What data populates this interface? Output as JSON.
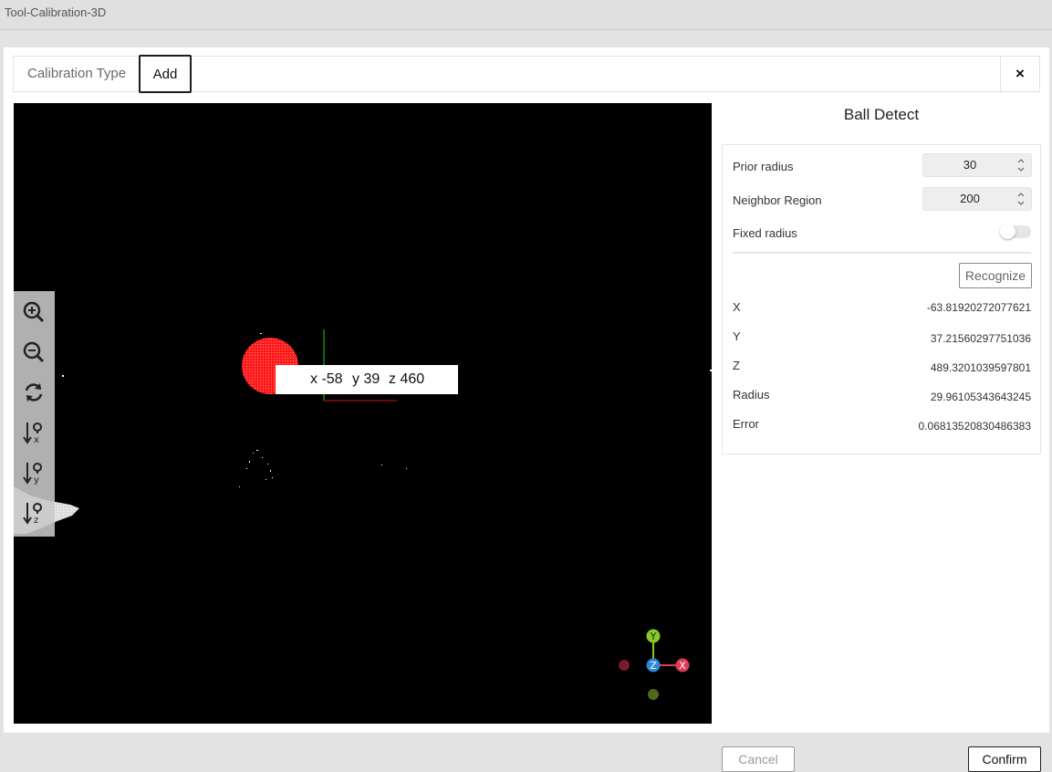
{
  "window": {
    "title": "Tool-Calibration-3D"
  },
  "tabs": [
    {
      "label": "Calibration Type"
    },
    {
      "label": "Add"
    }
  ],
  "close_icon": "×",
  "viewer": {
    "toolbar": [
      "zoom-in-icon",
      "zoom-out-icon",
      "reset-view-icon",
      "view-x-axis-icon",
      "view-y-axis-icon",
      "view-z-axis-icon"
    ],
    "popup": {
      "x": "x -58",
      "y": "y 39",
      "z": "z 460"
    },
    "axes": {
      "x": "X",
      "y": "Y",
      "z": "Z"
    },
    "colors": {
      "background": "#000000",
      "ball": "#ff1a1a"
    }
  },
  "panel": {
    "title": "Ball Detect",
    "prior_radius": {
      "label": "Prior radius",
      "value": "30"
    },
    "neighbor_region": {
      "label": "Neighbor Region",
      "value": "200"
    },
    "fixed_radius": {
      "label": "Fixed radius",
      "on": false
    },
    "recognize": "Recognize",
    "results": [
      {
        "label": "X",
        "value": "-63.81920272077621"
      },
      {
        "label": "Y",
        "value": "37.21560297751036"
      },
      {
        "label": "Z",
        "value": "489.3201039597801"
      },
      {
        "label": "Radius",
        "value": "29.96105343643245"
      },
      {
        "label": "Error",
        "value": "0.06813520830486383"
      }
    ]
  },
  "footer": {
    "cancel": "Cancel",
    "confirm": "Confirm"
  }
}
